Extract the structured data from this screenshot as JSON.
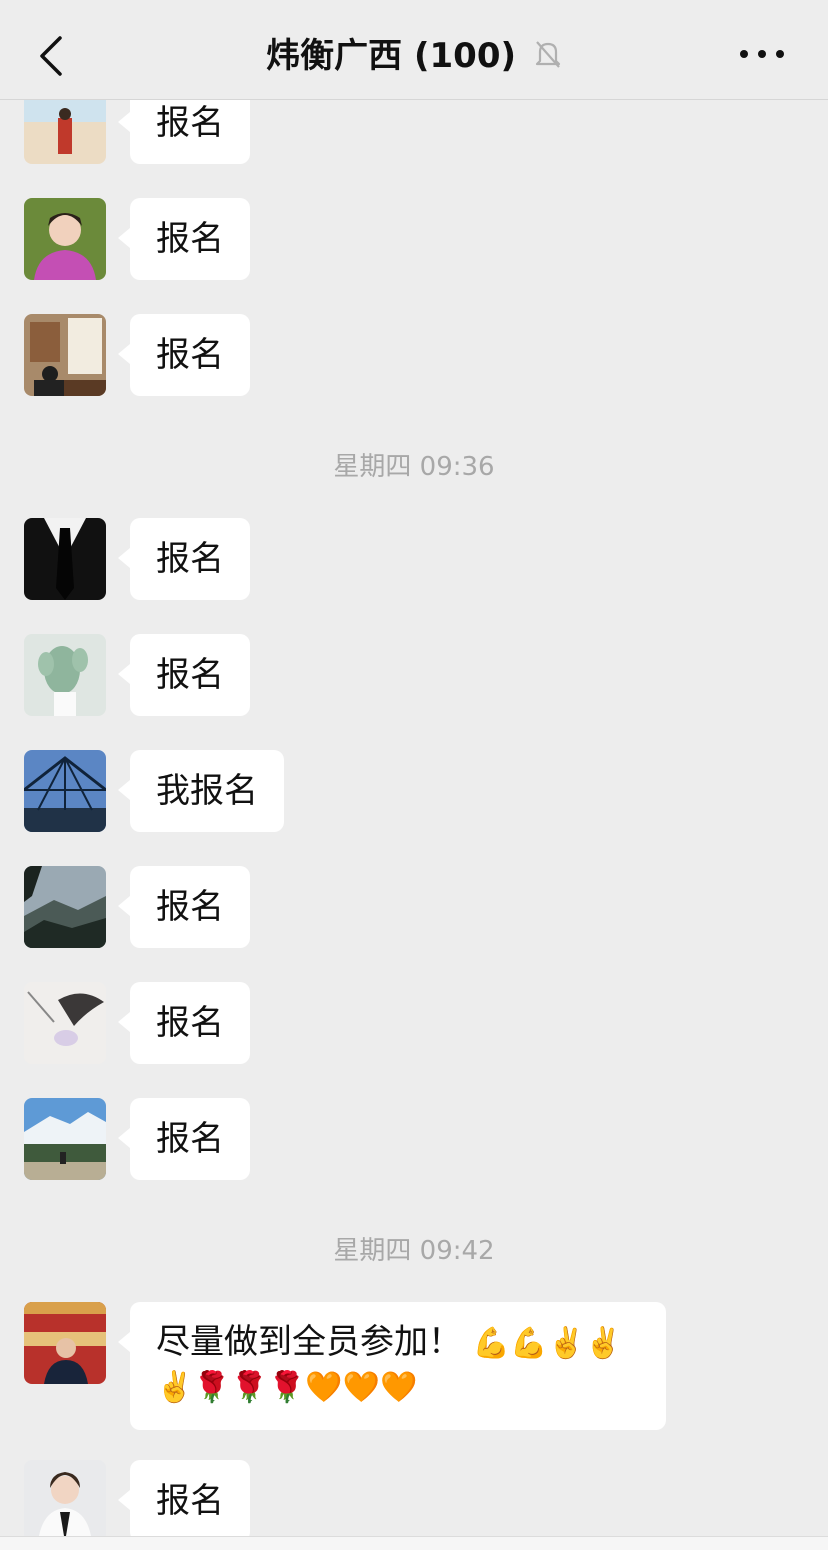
{
  "header": {
    "title": "炜衡广西 (100)",
    "back_icon": "chevron-left-icon",
    "mute_icon": "bell-off-icon",
    "more_icon": "ellipsis-icon"
  },
  "timestamps": [
    "星期四 09:36",
    "星期四 09:42"
  ],
  "messages": [
    {
      "text": "报名",
      "avatar": "beach-avatar"
    },
    {
      "text": "报名",
      "avatar": "woman-avatar"
    },
    {
      "text": "报名",
      "avatar": "calligraphy-avatar"
    },
    {
      "text": "报名",
      "avatar": "suit-avatar"
    },
    {
      "text": "报名",
      "avatar": "cactus-avatar"
    },
    {
      "text": "我报名",
      "avatar": "glasshouse-avatar"
    },
    {
      "text": "报名",
      "avatar": "mountain-avatar"
    },
    {
      "text": "报名",
      "avatar": "flower-sketch-avatar"
    },
    {
      "text": "报名",
      "avatar": "snow-mountain-avatar"
    },
    {
      "text_line1": "尽量做到全员参加！",
      "emojis_line1": "💪💪✌️✌️",
      "emojis_line2": "✌️🌹🌹🌹🧡🧡🧡",
      "avatar": "stage-man-avatar"
    },
    {
      "text": "报名",
      "avatar": "businesswoman-avatar"
    }
  ]
}
